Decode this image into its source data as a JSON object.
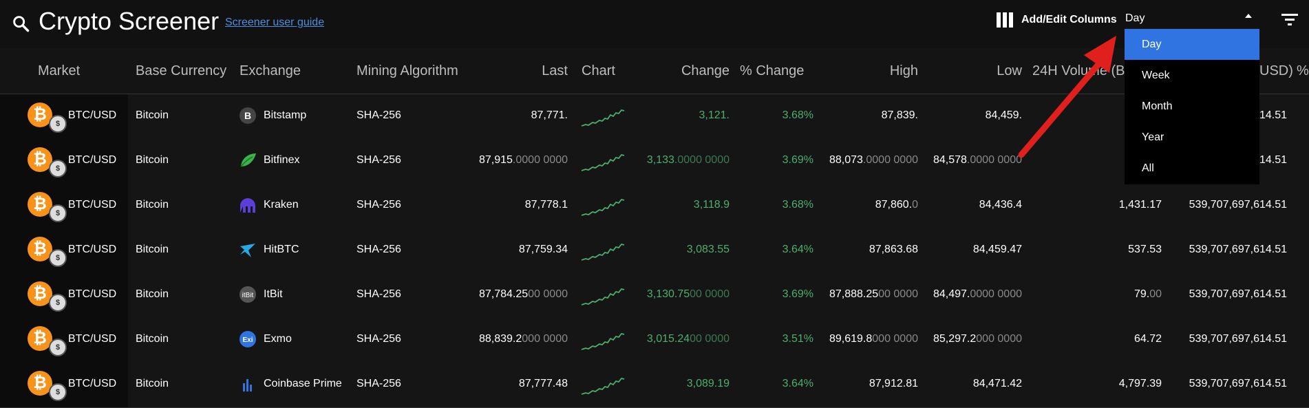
{
  "app": {
    "title": "Crypto Screener",
    "guide_link": "Screener user guide",
    "add_edit_columns": "Add/Edit Columns",
    "period_selected": "Day"
  },
  "colors": {
    "accent": "#2f74e0",
    "positive": "#4caf6e",
    "arrow": "#e0201c",
    "bitcoin": "#f7931a"
  },
  "period_options": [
    "Day",
    "Week",
    "Month",
    "Year",
    "All"
  ],
  "columns": [
    "Market",
    "Base Currency",
    "Exchange",
    "Mining Algorithm",
    "Last",
    "Chart",
    "Change",
    "% Change",
    "High",
    "Low",
    "24H Volume (B",
    "USD)",
    "%"
  ],
  "rows": [
    {
      "market": "BTC/USD",
      "base": "Bitcoin",
      "exchange": "Bitstamp",
      "exchange_icon": "bitstamp-icon",
      "algo": "SHA-256",
      "last": "87,771.",
      "last_dim": "",
      "change": "3,121.",
      "change_dim": "",
      "pct": "3.68%",
      "high": "87,839.",
      "high_dim": "",
      "low": "84,459.",
      "low_dim": "",
      "volume": "",
      "volume_dim": "",
      "mcap": "614.51"
    },
    {
      "market": "BTC/USD",
      "base": "Bitcoin",
      "exchange": "Bitfinex",
      "exchange_icon": "bitfinex-icon",
      "algo": "SHA-256",
      "last": "87,915",
      "last_dim": ".0000 0000",
      "change": "3,133",
      "change_dim": ".0000 0000",
      "pct": "3.69%",
      "high": "88,073",
      "high_dim": ".0000 0000",
      "low": "84,578",
      "low_dim": ".0000 0000",
      "volume": "",
      "volume_dim": "",
      "mcap": "14.51"
    },
    {
      "market": "BTC/USD",
      "base": "Bitcoin",
      "exchange": "Kraken",
      "exchange_icon": "kraken-icon",
      "algo": "SHA-256",
      "last": "87,778.1",
      "last_dim": "",
      "change": "3,118.9",
      "change_dim": "",
      "pct": "3.68%",
      "high": "87,860.",
      "high_dim": "0",
      "low": "84,436.4",
      "low_dim": "",
      "volume": "1,431.17",
      "volume_dim": "",
      "mcap": "539,707,697,614.51"
    },
    {
      "market": "BTC/USD",
      "base": "Bitcoin",
      "exchange": "HitBTC",
      "exchange_icon": "hitbtc-icon",
      "algo": "SHA-256",
      "last": "87,759.34",
      "last_dim": "",
      "change": "3,083.55",
      "change_dim": "",
      "pct": "3.64%",
      "high": "87,863.68",
      "high_dim": "",
      "low": "84,459.47",
      "low_dim": "",
      "volume": "537.53",
      "volume_dim": "",
      "mcap": "539,707,697,614.51"
    },
    {
      "market": "BTC/USD",
      "base": "Bitcoin",
      "exchange": "ItBit",
      "exchange_icon": "itbit-icon",
      "algo": "SHA-256",
      "last": "87,784.25",
      "last_dim": "00 0000",
      "change": "3,130.75",
      "change_dim": "00 0000",
      "pct": "3.69%",
      "high": "87,888.25",
      "high_dim": "00 0000",
      "low": "84,497.",
      "low_dim": "0000 0000",
      "volume": "79.",
      "volume_dim": "00",
      "mcap": "539,707,697,614.51"
    },
    {
      "market": "BTC/USD",
      "base": "Bitcoin",
      "exchange": "Exmo",
      "exchange_icon": "exmo-icon",
      "algo": "SHA-256",
      "last": "88,839.2",
      "last_dim": "000 0000",
      "change": "3,015.24",
      "change_dim": "00 0000",
      "pct": "3.51%",
      "high": "89,619.8",
      "high_dim": "000 0000",
      "low": "85,297.2",
      "low_dim": "000 0000",
      "volume": "64.72",
      "volume_dim": "",
      "mcap": "539,707,697,614.51"
    },
    {
      "market": "BTC/USD",
      "base": "Bitcoin",
      "exchange": "Coinbase Prime",
      "exchange_icon": "coinbase-prime-icon",
      "algo": "SHA-256",
      "last": "87,777.48",
      "last_dim": "",
      "change": "3,089.19",
      "change_dim": "",
      "pct": "3.64%",
      "high": "87,912.81",
      "high_dim": "",
      "low": "84,471.42",
      "low_dim": "",
      "volume": "4,797.39",
      "volume_dim": "",
      "mcap": "539,707,697,614.51"
    }
  ]
}
